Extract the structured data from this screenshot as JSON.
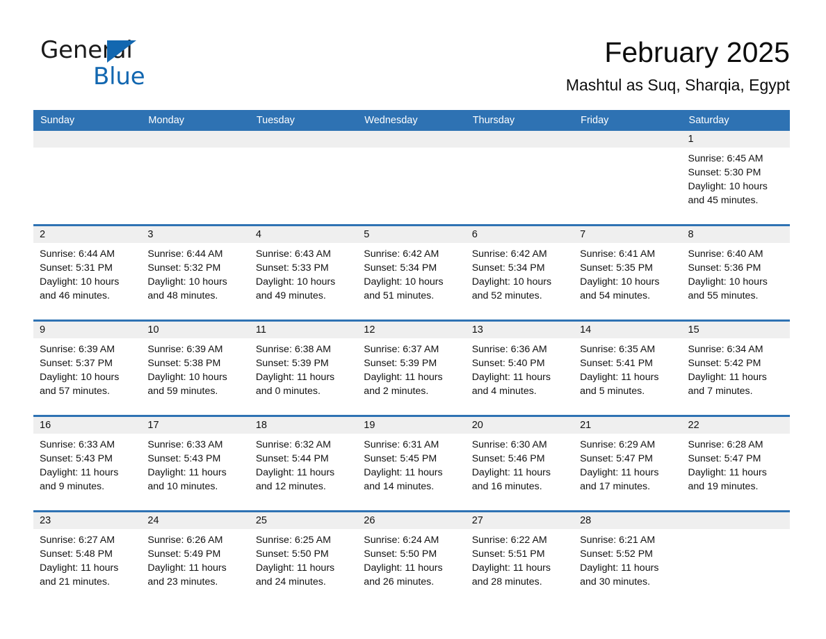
{
  "logo": {
    "word_one": "General",
    "word_two": "Blue",
    "triangle_color": "#1267b0"
  },
  "header": {
    "title": "February 2025",
    "subtitle": "Mashtul as Suq, Sharqia, Egypt"
  },
  "theme": {
    "header_blue": "#2e72b3",
    "daynum_band": "#efefef",
    "text": "#111111"
  },
  "weekdays": [
    "Sunday",
    "Monday",
    "Tuesday",
    "Wednesday",
    "Thursday",
    "Friday",
    "Saturday"
  ],
  "weeks": [
    [
      {
        "day": "",
        "sunrise": "",
        "sunset": "",
        "daylight_1": "",
        "daylight_2": ""
      },
      {
        "day": "",
        "sunrise": "",
        "sunset": "",
        "daylight_1": "",
        "daylight_2": ""
      },
      {
        "day": "",
        "sunrise": "",
        "sunset": "",
        "daylight_1": "",
        "daylight_2": ""
      },
      {
        "day": "",
        "sunrise": "",
        "sunset": "",
        "daylight_1": "",
        "daylight_2": ""
      },
      {
        "day": "",
        "sunrise": "",
        "sunset": "",
        "daylight_1": "",
        "daylight_2": ""
      },
      {
        "day": "",
        "sunrise": "",
        "sunset": "",
        "daylight_1": "",
        "daylight_2": ""
      },
      {
        "day": "1",
        "sunrise": "Sunrise: 6:45 AM",
        "sunset": "Sunset: 5:30 PM",
        "daylight_1": "Daylight: 10 hours",
        "daylight_2": "and 45 minutes."
      }
    ],
    [
      {
        "day": "2",
        "sunrise": "Sunrise: 6:44 AM",
        "sunset": "Sunset: 5:31 PM",
        "daylight_1": "Daylight: 10 hours",
        "daylight_2": "and 46 minutes."
      },
      {
        "day": "3",
        "sunrise": "Sunrise: 6:44 AM",
        "sunset": "Sunset: 5:32 PM",
        "daylight_1": "Daylight: 10 hours",
        "daylight_2": "and 48 minutes."
      },
      {
        "day": "4",
        "sunrise": "Sunrise: 6:43 AM",
        "sunset": "Sunset: 5:33 PM",
        "daylight_1": "Daylight: 10 hours",
        "daylight_2": "and 49 minutes."
      },
      {
        "day": "5",
        "sunrise": "Sunrise: 6:42 AM",
        "sunset": "Sunset: 5:34 PM",
        "daylight_1": "Daylight: 10 hours",
        "daylight_2": "and 51 minutes."
      },
      {
        "day": "6",
        "sunrise": "Sunrise: 6:42 AM",
        "sunset": "Sunset: 5:34 PM",
        "daylight_1": "Daylight: 10 hours",
        "daylight_2": "and 52 minutes."
      },
      {
        "day": "7",
        "sunrise": "Sunrise: 6:41 AM",
        "sunset": "Sunset: 5:35 PM",
        "daylight_1": "Daylight: 10 hours",
        "daylight_2": "and 54 minutes."
      },
      {
        "day": "8",
        "sunrise": "Sunrise: 6:40 AM",
        "sunset": "Sunset: 5:36 PM",
        "daylight_1": "Daylight: 10 hours",
        "daylight_2": "and 55 minutes."
      }
    ],
    [
      {
        "day": "9",
        "sunrise": "Sunrise: 6:39 AM",
        "sunset": "Sunset: 5:37 PM",
        "daylight_1": "Daylight: 10 hours",
        "daylight_2": "and 57 minutes."
      },
      {
        "day": "10",
        "sunrise": "Sunrise: 6:39 AM",
        "sunset": "Sunset: 5:38 PM",
        "daylight_1": "Daylight: 10 hours",
        "daylight_2": "and 59 minutes."
      },
      {
        "day": "11",
        "sunrise": "Sunrise: 6:38 AM",
        "sunset": "Sunset: 5:39 PM",
        "daylight_1": "Daylight: 11 hours",
        "daylight_2": "and 0 minutes."
      },
      {
        "day": "12",
        "sunrise": "Sunrise: 6:37 AM",
        "sunset": "Sunset: 5:39 PM",
        "daylight_1": "Daylight: 11 hours",
        "daylight_2": "and 2 minutes."
      },
      {
        "day": "13",
        "sunrise": "Sunrise: 6:36 AM",
        "sunset": "Sunset: 5:40 PM",
        "daylight_1": "Daylight: 11 hours",
        "daylight_2": "and 4 minutes."
      },
      {
        "day": "14",
        "sunrise": "Sunrise: 6:35 AM",
        "sunset": "Sunset: 5:41 PM",
        "daylight_1": "Daylight: 11 hours",
        "daylight_2": "and 5 minutes."
      },
      {
        "day": "15",
        "sunrise": "Sunrise: 6:34 AM",
        "sunset": "Sunset: 5:42 PM",
        "daylight_1": "Daylight: 11 hours",
        "daylight_2": "and 7 minutes."
      }
    ],
    [
      {
        "day": "16",
        "sunrise": "Sunrise: 6:33 AM",
        "sunset": "Sunset: 5:43 PM",
        "daylight_1": "Daylight: 11 hours",
        "daylight_2": "and 9 minutes."
      },
      {
        "day": "17",
        "sunrise": "Sunrise: 6:33 AM",
        "sunset": "Sunset: 5:43 PM",
        "daylight_1": "Daylight: 11 hours",
        "daylight_2": "and 10 minutes."
      },
      {
        "day": "18",
        "sunrise": "Sunrise: 6:32 AM",
        "sunset": "Sunset: 5:44 PM",
        "daylight_1": "Daylight: 11 hours",
        "daylight_2": "and 12 minutes."
      },
      {
        "day": "19",
        "sunrise": "Sunrise: 6:31 AM",
        "sunset": "Sunset: 5:45 PM",
        "daylight_1": "Daylight: 11 hours",
        "daylight_2": "and 14 minutes."
      },
      {
        "day": "20",
        "sunrise": "Sunrise: 6:30 AM",
        "sunset": "Sunset: 5:46 PM",
        "daylight_1": "Daylight: 11 hours",
        "daylight_2": "and 16 minutes."
      },
      {
        "day": "21",
        "sunrise": "Sunrise: 6:29 AM",
        "sunset": "Sunset: 5:47 PM",
        "daylight_1": "Daylight: 11 hours",
        "daylight_2": "and 17 minutes."
      },
      {
        "day": "22",
        "sunrise": "Sunrise: 6:28 AM",
        "sunset": "Sunset: 5:47 PM",
        "daylight_1": "Daylight: 11 hours",
        "daylight_2": "and 19 minutes."
      }
    ],
    [
      {
        "day": "23",
        "sunrise": "Sunrise: 6:27 AM",
        "sunset": "Sunset: 5:48 PM",
        "daylight_1": "Daylight: 11 hours",
        "daylight_2": "and 21 minutes."
      },
      {
        "day": "24",
        "sunrise": "Sunrise: 6:26 AM",
        "sunset": "Sunset: 5:49 PM",
        "daylight_1": "Daylight: 11 hours",
        "daylight_2": "and 23 minutes."
      },
      {
        "day": "25",
        "sunrise": "Sunrise: 6:25 AM",
        "sunset": "Sunset: 5:50 PM",
        "daylight_1": "Daylight: 11 hours",
        "daylight_2": "and 24 minutes."
      },
      {
        "day": "26",
        "sunrise": "Sunrise: 6:24 AM",
        "sunset": "Sunset: 5:50 PM",
        "daylight_1": "Daylight: 11 hours",
        "daylight_2": "and 26 minutes."
      },
      {
        "day": "27",
        "sunrise": "Sunrise: 6:22 AM",
        "sunset": "Sunset: 5:51 PM",
        "daylight_1": "Daylight: 11 hours",
        "daylight_2": "and 28 minutes."
      },
      {
        "day": "28",
        "sunrise": "Sunrise: 6:21 AM",
        "sunset": "Sunset: 5:52 PM",
        "daylight_1": "Daylight: 11 hours",
        "daylight_2": "and 30 minutes."
      },
      {
        "day": "",
        "sunrise": "",
        "sunset": "",
        "daylight_1": "",
        "daylight_2": ""
      }
    ]
  ]
}
